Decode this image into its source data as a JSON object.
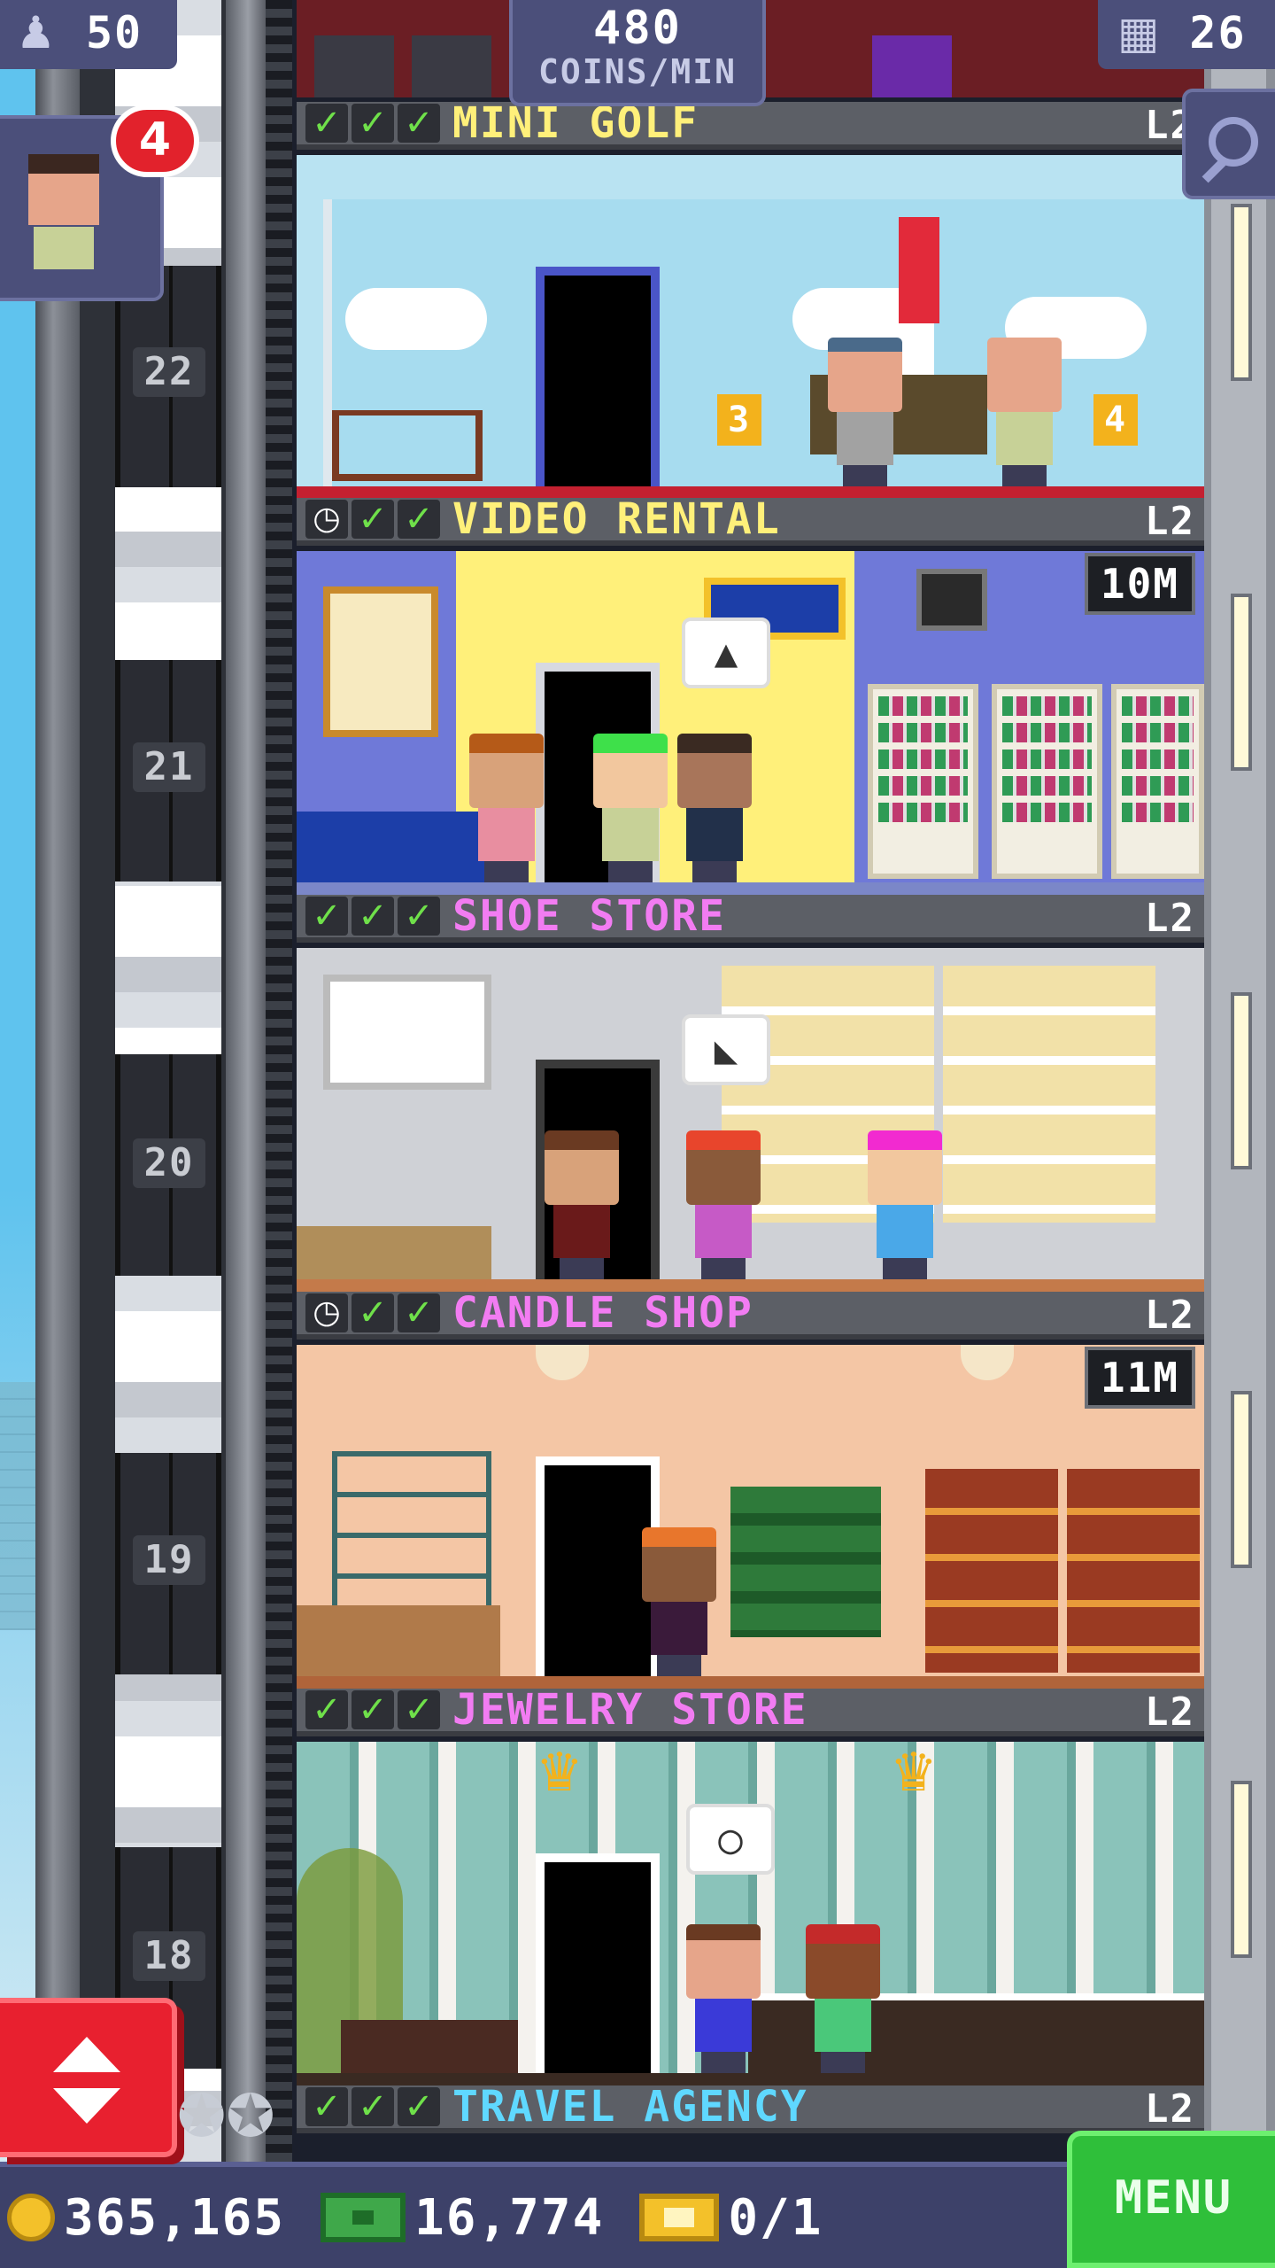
{
  "hud": {
    "population": "50",
    "coins_per_min_value": "480",
    "coins_per_min_unit": "COINS/MIN",
    "floor_count": "26"
  },
  "visitor": {
    "badge_count": "4"
  },
  "floors": [
    {
      "number": "22",
      "name": "MINI GOLF",
      "level": "L2",
      "status": [
        "check",
        "check",
        "check"
      ],
      "name_color": "#fff07a",
      "hole_labels": [
        "3",
        "4"
      ]
    },
    {
      "number": "21",
      "name": "VIDEO RENTAL",
      "level": "L2",
      "status": [
        "clock",
        "check",
        "check"
      ],
      "name_color": "#fff07a",
      "timer": "10M"
    },
    {
      "number": "20",
      "name": "SHOE STORE",
      "level": "L2",
      "status": [
        "check",
        "check",
        "check"
      ],
      "name_color": "#f27cf2"
    },
    {
      "number": "19",
      "name": "CANDLE SHOP",
      "level": "L2",
      "status": [
        "clock",
        "check",
        "check"
      ],
      "name_color": "#f27cf2",
      "timer": "11M"
    },
    {
      "number": "18",
      "name": "JEWELRY STORE",
      "level": "L2",
      "status": [
        "check",
        "check",
        "check"
      ],
      "name_color": "#f27cf2"
    },
    {
      "number": "",
      "name": "TRAVEL AGENCY",
      "level": "L2",
      "status": [
        "check",
        "check",
        "check"
      ],
      "name_color": "#5fd8ff"
    }
  ],
  "bottom": {
    "coins": "365,165",
    "bux": "16,774",
    "tickets": "0/1",
    "menu_label": "MENU"
  },
  "colors": {
    "hud_bg": "#4b4f7a",
    "check_green": "#6fe04a",
    "elevator_button": "#e8202f",
    "menu_green": "#2fbf3a"
  }
}
